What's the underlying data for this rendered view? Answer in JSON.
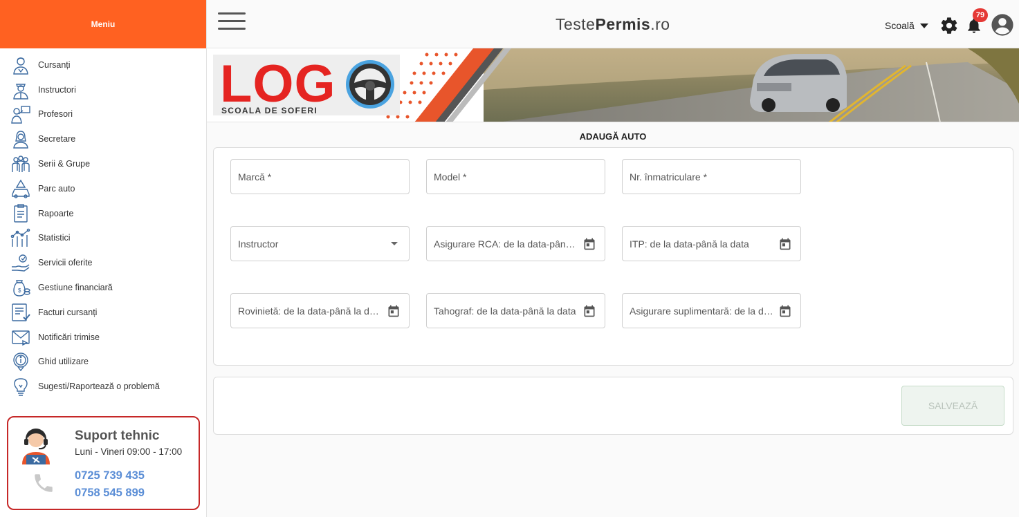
{
  "sidebar": {
    "header": "Meniu",
    "items": [
      {
        "label": "Cursanți",
        "icon": "student-icon"
      },
      {
        "label": "Instructori",
        "icon": "instructor-icon"
      },
      {
        "label": "Profesori",
        "icon": "teacher-icon"
      },
      {
        "label": "Secretare",
        "icon": "secretary-icon"
      },
      {
        "label": "Serii & Grupe",
        "icon": "group-icon"
      },
      {
        "label": "Parc auto",
        "icon": "car-fleet-icon"
      },
      {
        "label": "Rapoarte",
        "icon": "report-icon"
      },
      {
        "label": "Statistici",
        "icon": "statistics-icon"
      },
      {
        "label": "Servicii oferite",
        "icon": "services-icon"
      },
      {
        "label": "Gestiune financiară",
        "icon": "finance-icon"
      },
      {
        "label": "Facturi cursanți",
        "icon": "invoice-icon"
      },
      {
        "label": "Notificări trimise",
        "icon": "notification-sent-icon"
      },
      {
        "label": "Ghid utilizare",
        "icon": "guide-icon"
      },
      {
        "label": "Sugesti/Raportează o problemă",
        "icon": "suggestion-icon"
      }
    ],
    "support": {
      "title": "Suport tehnic",
      "hours": "Luni - Vineri 09:00 - 17:00",
      "phone1": "0725 739 435",
      "phone2": "0758 545 899"
    }
  },
  "topbar": {
    "brand_light": "Teste",
    "brand_bold": "Permis",
    "brand_suffix": ".ro",
    "school_label": "Scoală",
    "notification_count": "79"
  },
  "banner": {
    "logo_text": "LOG",
    "logo_subtitle": "SCOALA DE SOFERI"
  },
  "form": {
    "title": "ADAUGĂ AUTO",
    "fields": {
      "brand": "Marcă *",
      "model": "Model *",
      "plate": "Nr. înmatriculare *",
      "instructor": "Instructor",
      "rca": "Asigurare RCA: de la data-până la data",
      "itp": "ITP: de la data-până la data",
      "vignette": "Rovinietă: de la data-până la data",
      "tachograph": "Tahograf: de la data-până la data",
      "extra_insurance": "Asigurare suplimentară: de la data-până la data"
    },
    "save_label": "SALVEAZĂ"
  },
  "colors": {
    "accent": "#ff6121",
    "support_border": "#c62828",
    "phone_blue": "#5b8ed6",
    "badge_red": "#e53935"
  }
}
